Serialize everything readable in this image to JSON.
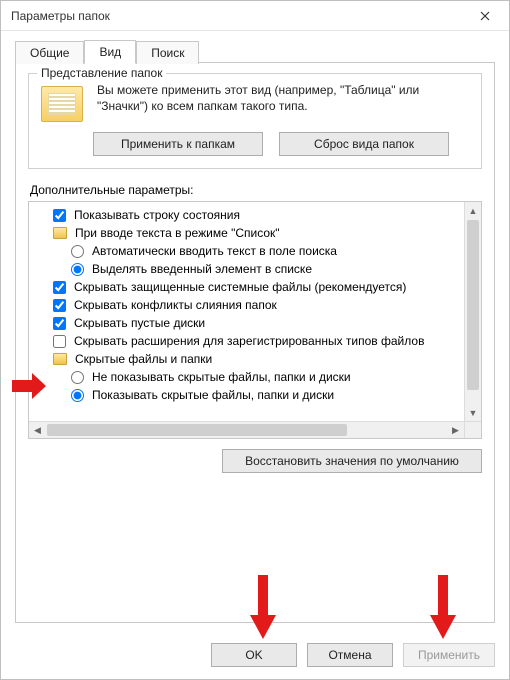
{
  "window": {
    "title": "Параметры папок"
  },
  "tabs": {
    "general": "Общие",
    "view": "Вид",
    "search": "Поиск"
  },
  "group": {
    "title": "Представление папок",
    "desc": "Вы можете применить этот вид (например, \"Таблица\" или \"Значки\") ко всем папкам такого типа.",
    "apply": "Применить к папкам",
    "reset": "Сброс вида папок"
  },
  "adv": {
    "label": "Дополнительные параметры:",
    "items": [
      {
        "kind": "check",
        "indent": 1,
        "checked": true,
        "text": "Показывать строку состояния"
      },
      {
        "kind": "folder",
        "indent": 1,
        "text": "При вводе текста в режиме \"Список\""
      },
      {
        "kind": "radio",
        "indent": 2,
        "checked": false,
        "text": "Автоматически вводить текст в поле поиска"
      },
      {
        "kind": "radio",
        "indent": 2,
        "checked": true,
        "text": "Выделять введенный элемент в списке"
      },
      {
        "kind": "check",
        "indent": 1,
        "checked": true,
        "text": "Скрывать защищенные системные файлы (рекомендуется)"
      },
      {
        "kind": "check",
        "indent": 1,
        "checked": true,
        "text": "Скрывать конфликты слияния папок"
      },
      {
        "kind": "check",
        "indent": 1,
        "checked": true,
        "text": "Скрывать пустые диски"
      },
      {
        "kind": "check",
        "indent": 1,
        "checked": false,
        "text": "Скрывать расширения для зарегистрированных типов файлов"
      },
      {
        "kind": "folder",
        "indent": 1,
        "text": "Скрытые файлы и папки"
      },
      {
        "kind": "radio",
        "indent": 2,
        "checked": false,
        "text": "Не показывать скрытые файлы, папки и диски"
      },
      {
        "kind": "radio",
        "indent": 2,
        "checked": true,
        "text": "Показывать скрытые файлы, папки и диски"
      }
    ],
    "restore": "Восстановить значения по умолчанию"
  },
  "footer": {
    "ok": "OK",
    "cancel": "Отмена",
    "apply": "Применить"
  }
}
